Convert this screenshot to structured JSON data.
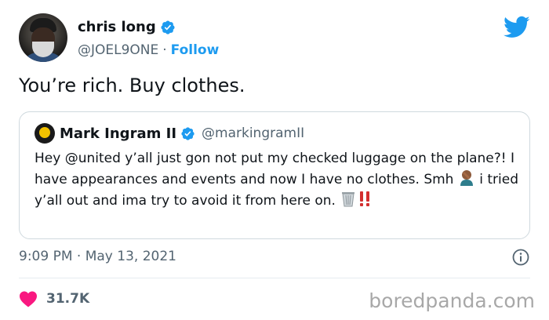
{
  "author": {
    "display_name": "chris long",
    "handle": "@JOEL9ONE",
    "separator": "·",
    "follow_label": "Follow"
  },
  "tweet": {
    "text": "You’re rich. Buy clothes.",
    "time": "9:09 PM",
    "date": "May 13, 2021",
    "meta_separator": "·"
  },
  "quoted": {
    "display_name": "Mark Ingram II",
    "handle": "@markingramII",
    "text_part1": "Hey @united y’all just gon not put my checked luggage on the plane?! I have appearances and events and now I have no clothes. Smh ",
    "text_part2": " i tried y’all out and ima try to avoid it from here on. "
  },
  "engagement": {
    "likes": "31.7K"
  },
  "watermark": "boredpanda.com",
  "icons": [
    "verified-badge-icon",
    "twitter-bird-icon",
    "info-icon",
    "heart-icon",
    "facepalm-emoji",
    "wastebasket-emoji",
    "double-exclamation-emoji"
  ],
  "colors": {
    "accent": "#1d9bf0",
    "heart": "#f91880",
    "text": "#0f1419",
    "secondary": "#536471"
  }
}
